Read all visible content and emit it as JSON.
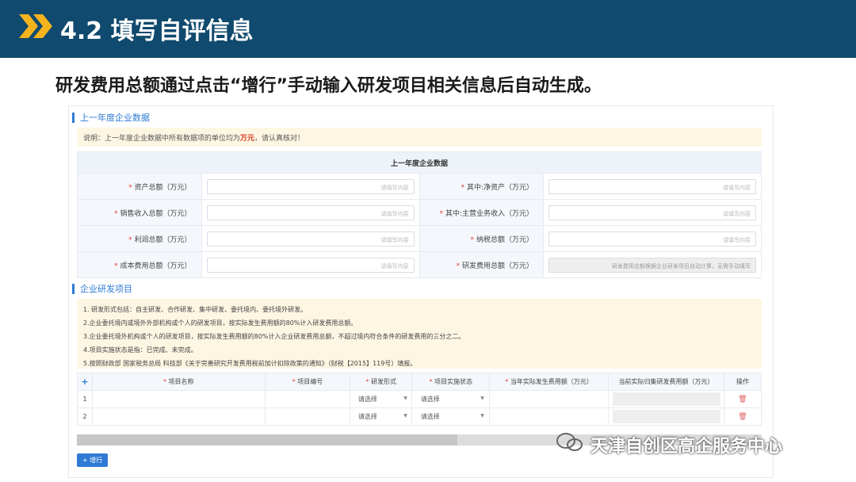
{
  "header": {
    "title": "4.2 填写自评信息"
  },
  "subtitle": "研发费用总额通过点击“增行”手动输入研发项目相关信息后自动生成。",
  "section1": {
    "title": "上一年度企业数据",
    "note_prefix": "说明：上一年度企业数据中所有数据项的单位均为",
    "note_unit": "万元",
    "note_suffix": "，请认真核对！",
    "table_header": "上一年度企业数据",
    "placeholder": "请填写内容",
    "fields": [
      {
        "label": "资产总额（万元）"
      },
      {
        "label": "其中:净资产（万元）"
      },
      {
        "label": "销售收入总额（万元）"
      },
      {
        "label": "其中:主营业务收入（万元）"
      },
      {
        "label": "利润总额（万元）"
      },
      {
        "label": "纳税总额（万元）"
      },
      {
        "label": "成本费用总额（万元）"
      },
      {
        "label": "研发费用总额（万元）",
        "placeholder": "研发费用总额根据企业研发项目自动计算，无需手动填写"
      }
    ]
  },
  "section2": {
    "title": "企业研发项目",
    "rules": [
      "1. 研发形式包括：自主研发、合作研发、集中研发、委托境内、委托境外研发。",
      "2.企业委托境内或境外外部机构或个人的研发项目，按实际发生费用额的80%计入研发费用总额。",
      "3.企业委托境外机构或个人的研发项目，按实际发生费用额的80%计入企业研发费用总额，不超过境内符合条件的研发费用的三分之二。",
      "4.项目实施状态是指：已完成、未完成。",
      "5.按照财政部 国家税务总局 科技部《关于完善研究开发费用税前加计扣除政策的通知》（财税【2015】119号）填报。"
    ],
    "columns": {
      "add": "+",
      "name": "项目名称",
      "code": "项目编号",
      "form": "研发形式",
      "status": "项目实施状态",
      "actual": "当年实际发生费用额（万元）",
      "collected": "当前实际归集研发费用额（万元）",
      "op": "操作"
    },
    "rows": [
      {
        "index": "1",
        "form": "请选择",
        "status": "请选择"
      },
      {
        "index": "2",
        "form": "请选择",
        "status": "请选择"
      }
    ],
    "add_row_label": "+ 增行"
  },
  "watermark": "天津自创区高企服务中心"
}
